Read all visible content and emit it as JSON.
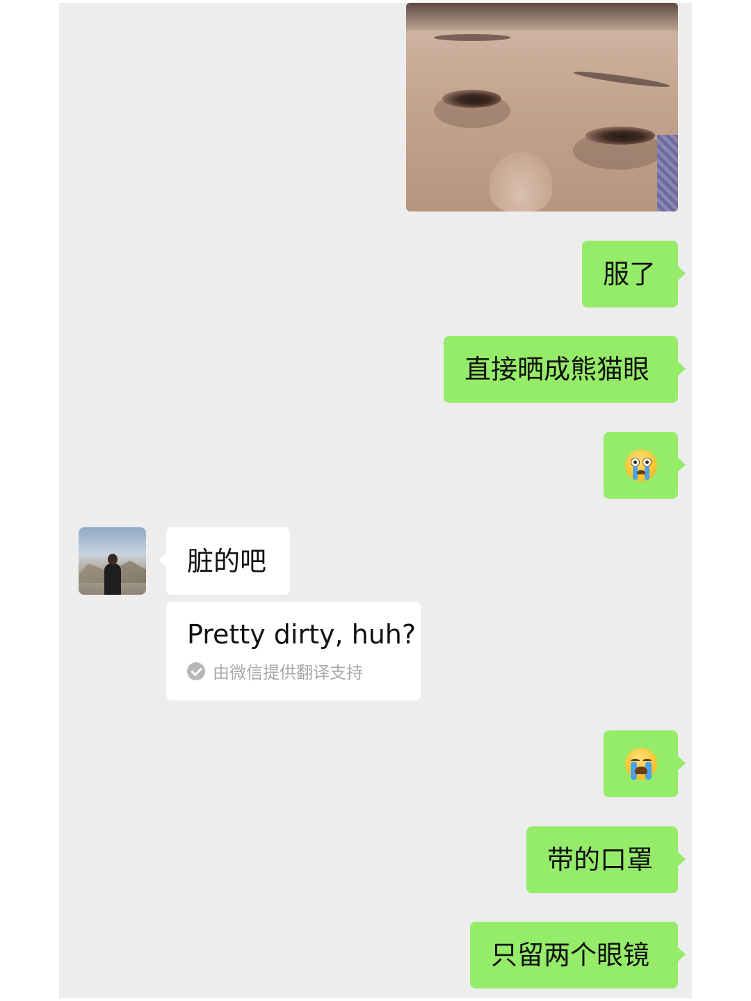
{
  "chat": {
    "messages": [
      {
        "id": "photo",
        "kind": "image",
        "direction": "sent",
        "image_description_icon": "selfie-photo"
      },
      {
        "id": "m1",
        "kind": "text",
        "direction": "sent",
        "text": "服了"
      },
      {
        "id": "m2",
        "kind": "text",
        "direction": "sent",
        "text": "直接晒成熊猫眼"
      },
      {
        "id": "m3",
        "kind": "emoji",
        "direction": "sent",
        "icon": "crying-emoji"
      },
      {
        "id": "m4",
        "kind": "text",
        "direction": "received",
        "text": "脏的吧"
      },
      {
        "id": "m5",
        "kind": "emoji",
        "direction": "sent",
        "icon": "loudly-crying-emoji"
      },
      {
        "id": "m6",
        "kind": "text",
        "direction": "sent",
        "text": "带的口罩"
      },
      {
        "id": "m7",
        "kind": "text",
        "direction": "sent",
        "text": "只留两个眼镜"
      }
    ],
    "translation": {
      "text": "Pretty dirty, huh?",
      "source_note": "由微信提供翻译支持"
    }
  },
  "colors": {
    "sent_bubble": "#95ec69",
    "received_bubble": "#ffffff",
    "chat_background": "#ededed"
  }
}
